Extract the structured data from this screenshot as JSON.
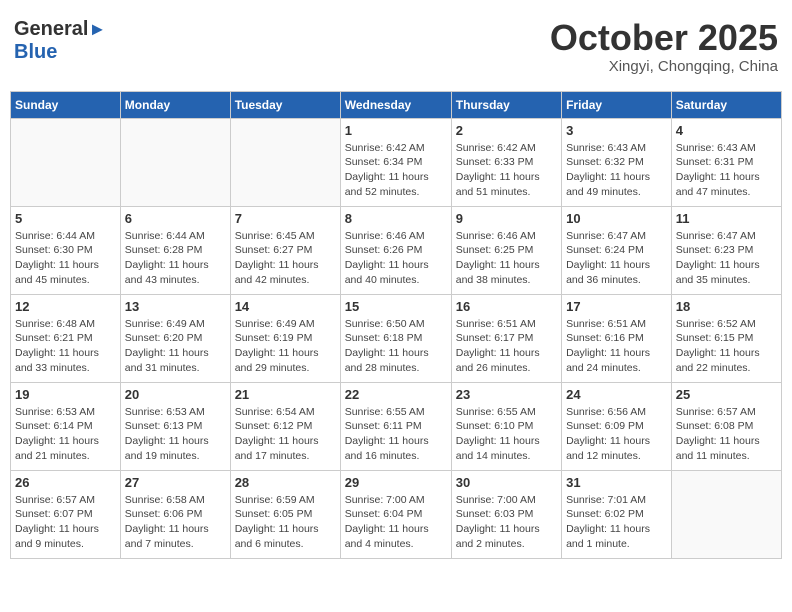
{
  "header": {
    "logo_general": "General",
    "logo_blue": "Blue",
    "month_title": "October 2025",
    "subtitle": "Xingyi, Chongqing, China"
  },
  "weekdays": [
    "Sunday",
    "Monday",
    "Tuesday",
    "Wednesday",
    "Thursday",
    "Friday",
    "Saturday"
  ],
  "weeks": [
    [
      {
        "day": "",
        "info": ""
      },
      {
        "day": "",
        "info": ""
      },
      {
        "day": "",
        "info": ""
      },
      {
        "day": "1",
        "info": "Sunrise: 6:42 AM\nSunset: 6:34 PM\nDaylight: 11 hours and 52 minutes."
      },
      {
        "day": "2",
        "info": "Sunrise: 6:42 AM\nSunset: 6:33 PM\nDaylight: 11 hours and 51 minutes."
      },
      {
        "day": "3",
        "info": "Sunrise: 6:43 AM\nSunset: 6:32 PM\nDaylight: 11 hours and 49 minutes."
      },
      {
        "day": "4",
        "info": "Sunrise: 6:43 AM\nSunset: 6:31 PM\nDaylight: 11 hours and 47 minutes."
      }
    ],
    [
      {
        "day": "5",
        "info": "Sunrise: 6:44 AM\nSunset: 6:30 PM\nDaylight: 11 hours and 45 minutes."
      },
      {
        "day": "6",
        "info": "Sunrise: 6:44 AM\nSunset: 6:28 PM\nDaylight: 11 hours and 43 minutes."
      },
      {
        "day": "7",
        "info": "Sunrise: 6:45 AM\nSunset: 6:27 PM\nDaylight: 11 hours and 42 minutes."
      },
      {
        "day": "8",
        "info": "Sunrise: 6:46 AM\nSunset: 6:26 PM\nDaylight: 11 hours and 40 minutes."
      },
      {
        "day": "9",
        "info": "Sunrise: 6:46 AM\nSunset: 6:25 PM\nDaylight: 11 hours and 38 minutes."
      },
      {
        "day": "10",
        "info": "Sunrise: 6:47 AM\nSunset: 6:24 PM\nDaylight: 11 hours and 36 minutes."
      },
      {
        "day": "11",
        "info": "Sunrise: 6:47 AM\nSunset: 6:23 PM\nDaylight: 11 hours and 35 minutes."
      }
    ],
    [
      {
        "day": "12",
        "info": "Sunrise: 6:48 AM\nSunset: 6:21 PM\nDaylight: 11 hours and 33 minutes."
      },
      {
        "day": "13",
        "info": "Sunrise: 6:49 AM\nSunset: 6:20 PM\nDaylight: 11 hours and 31 minutes."
      },
      {
        "day": "14",
        "info": "Sunrise: 6:49 AM\nSunset: 6:19 PM\nDaylight: 11 hours and 29 minutes."
      },
      {
        "day": "15",
        "info": "Sunrise: 6:50 AM\nSunset: 6:18 PM\nDaylight: 11 hours and 28 minutes."
      },
      {
        "day": "16",
        "info": "Sunrise: 6:51 AM\nSunset: 6:17 PM\nDaylight: 11 hours and 26 minutes."
      },
      {
        "day": "17",
        "info": "Sunrise: 6:51 AM\nSunset: 6:16 PM\nDaylight: 11 hours and 24 minutes."
      },
      {
        "day": "18",
        "info": "Sunrise: 6:52 AM\nSunset: 6:15 PM\nDaylight: 11 hours and 22 minutes."
      }
    ],
    [
      {
        "day": "19",
        "info": "Sunrise: 6:53 AM\nSunset: 6:14 PM\nDaylight: 11 hours and 21 minutes."
      },
      {
        "day": "20",
        "info": "Sunrise: 6:53 AM\nSunset: 6:13 PM\nDaylight: 11 hours and 19 minutes."
      },
      {
        "day": "21",
        "info": "Sunrise: 6:54 AM\nSunset: 6:12 PM\nDaylight: 11 hours and 17 minutes."
      },
      {
        "day": "22",
        "info": "Sunrise: 6:55 AM\nSunset: 6:11 PM\nDaylight: 11 hours and 16 minutes."
      },
      {
        "day": "23",
        "info": "Sunrise: 6:55 AM\nSunset: 6:10 PM\nDaylight: 11 hours and 14 minutes."
      },
      {
        "day": "24",
        "info": "Sunrise: 6:56 AM\nSunset: 6:09 PM\nDaylight: 11 hours and 12 minutes."
      },
      {
        "day": "25",
        "info": "Sunrise: 6:57 AM\nSunset: 6:08 PM\nDaylight: 11 hours and 11 minutes."
      }
    ],
    [
      {
        "day": "26",
        "info": "Sunrise: 6:57 AM\nSunset: 6:07 PM\nDaylight: 11 hours and 9 minutes."
      },
      {
        "day": "27",
        "info": "Sunrise: 6:58 AM\nSunset: 6:06 PM\nDaylight: 11 hours and 7 minutes."
      },
      {
        "day": "28",
        "info": "Sunrise: 6:59 AM\nSunset: 6:05 PM\nDaylight: 11 hours and 6 minutes."
      },
      {
        "day": "29",
        "info": "Sunrise: 7:00 AM\nSunset: 6:04 PM\nDaylight: 11 hours and 4 minutes."
      },
      {
        "day": "30",
        "info": "Sunrise: 7:00 AM\nSunset: 6:03 PM\nDaylight: 11 hours and 2 minutes."
      },
      {
        "day": "31",
        "info": "Sunrise: 7:01 AM\nSunset: 6:02 PM\nDaylight: 11 hours and 1 minute."
      },
      {
        "day": "",
        "info": ""
      }
    ]
  ]
}
